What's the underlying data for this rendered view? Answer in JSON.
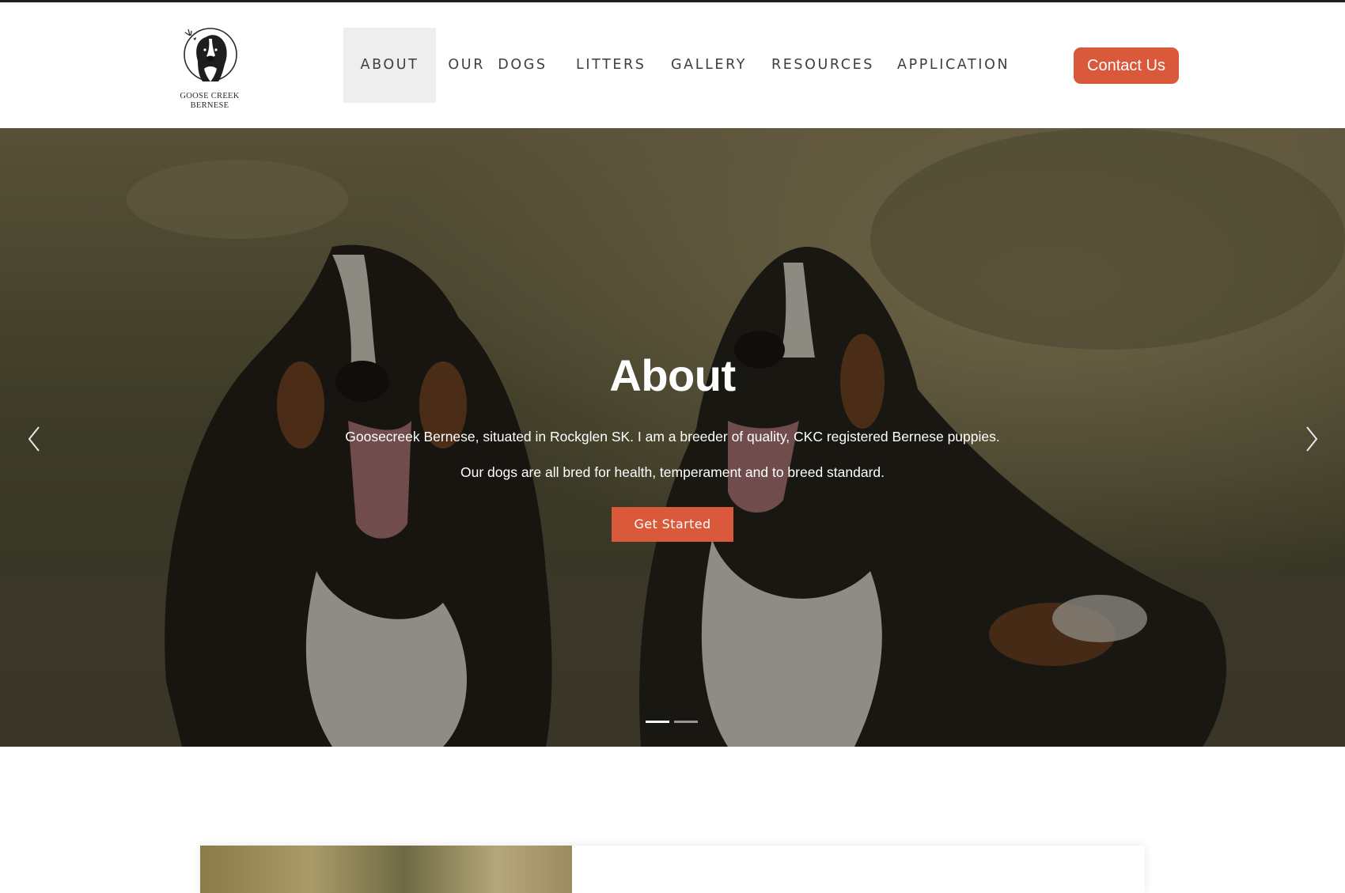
{
  "brand": {
    "name_line1": "GOOSE CREEK",
    "name_line2": "BERNESE",
    "logo_icon": "bernese-dog-logo-icon"
  },
  "nav": {
    "items": [
      {
        "label": "ABOUT",
        "active": true
      },
      {
        "label": "OUR  DOGS",
        "active": false
      },
      {
        "label": "LITTERS",
        "active": false
      },
      {
        "label": "GALLERY",
        "active": false
      },
      {
        "label": "RESOURCES",
        "active": false
      },
      {
        "label": "APPLICATION",
        "active": false
      }
    ],
    "contact_label": "Contact Us"
  },
  "hero": {
    "title": "About",
    "line1": "Goosecreek Bernese, situated in Rockglen SK. I am a breeder of quality, CKC registered Bernese puppies.",
    "line2": "Our dogs are all bred for health, temperament and to breed standard.",
    "cta_label": "Get Started",
    "prev_icon": "chevron-left-icon",
    "next_icon": "chevron-right-icon",
    "slide_count": 2,
    "active_slide": 1
  },
  "colors": {
    "accent": "#d9593a",
    "nav_text": "#3e3e3e",
    "active_nav_bg": "#eeeeee",
    "top_bar": "#1f1f1f"
  }
}
